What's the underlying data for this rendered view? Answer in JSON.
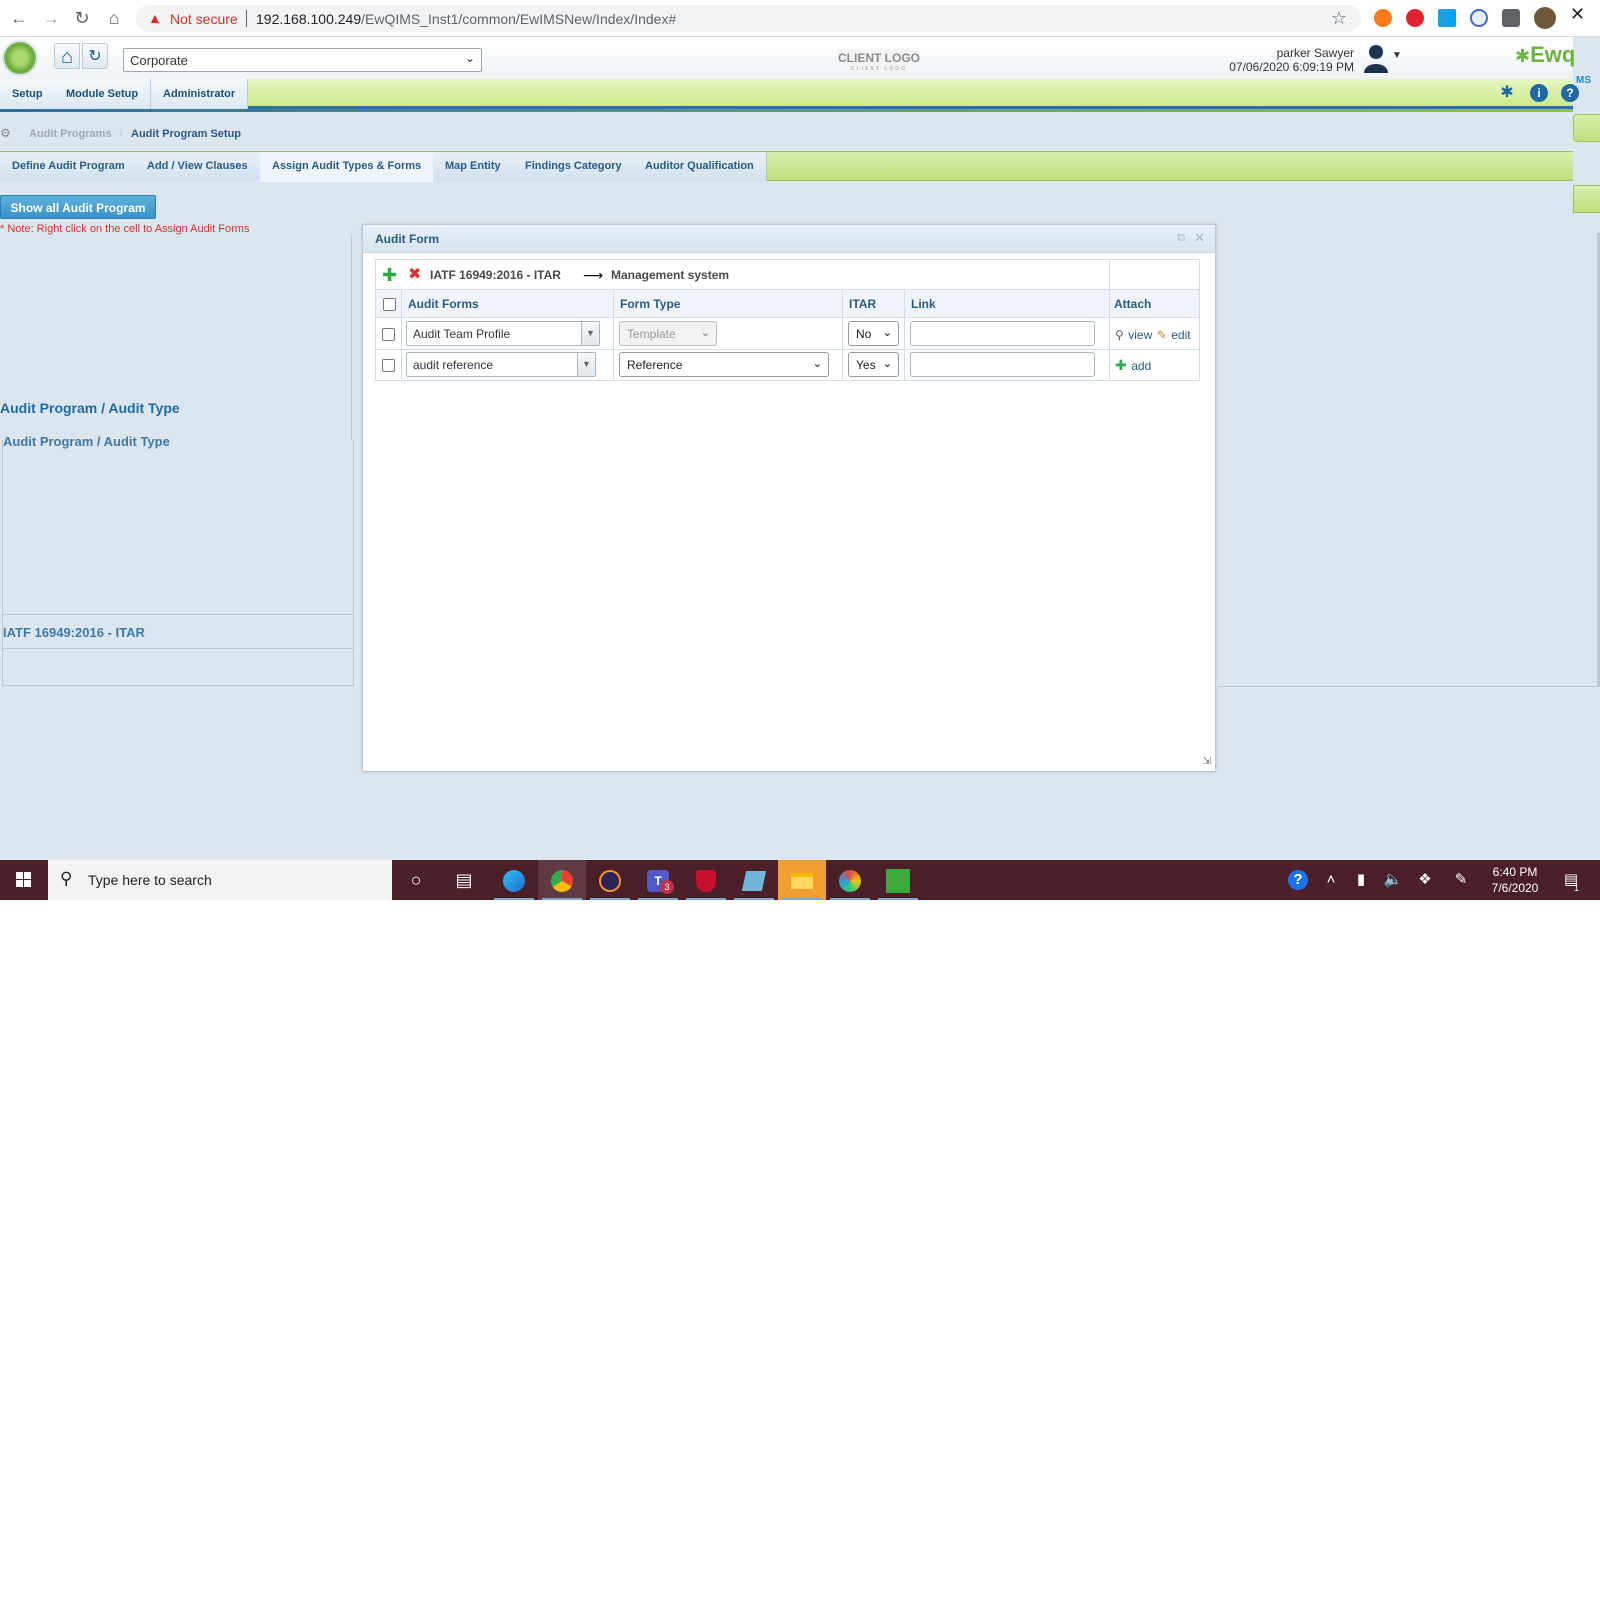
{
  "browser": {
    "security_label": "Not secure",
    "url_host": "192.168.100.249",
    "url_path": "/EwQIMS_Inst1/common/EwIMSNew/Index/Index#"
  },
  "header": {
    "site_selector": "Corporate",
    "client_logo": "CLIENT LOGO",
    "client_logo_sub": "CLIENT LOGO",
    "user_name": "parker Sawyer",
    "user_datetime": "07/06/2020 6:09:19 PM",
    "brand": "Ewq",
    "brand_sub": "MS"
  },
  "menu": {
    "items": [
      "Setup",
      "Module Setup",
      "Administrator"
    ]
  },
  "breadcrumb": {
    "items": [
      "Audit Programs",
      "Audit Program Setup"
    ]
  },
  "tabs": [
    {
      "label": "Define Audit Program"
    },
    {
      "label": "Add / View Clauses"
    },
    {
      "label": "Assign Audit Types & Forms",
      "active": true
    },
    {
      "label": "Map Entity"
    },
    {
      "label": "Findings Category"
    },
    {
      "label": "Auditor Qualification"
    }
  ],
  "left_panel": {
    "show_all_button": "Show all Audit Program",
    "note": "* Note: Right click on the cell to Assign Audit Forms",
    "header_label": "Audit Program / Audit Type",
    "header_label_2": "Audit Program / Audit Type",
    "row_label": "IATF 16949:2016 - ITAR"
  },
  "dialog": {
    "title": "Audit Form",
    "path_program": "IATF 16949:2016 - ITAR",
    "path_section": "Management system",
    "columns": {
      "forms": "Audit Forms",
      "type": "Form Type",
      "itar": "ITAR",
      "link": "Link",
      "attach": "Attach"
    },
    "rows": [
      {
        "form": "Audit Team Profile",
        "type": "Template",
        "itar": "No",
        "link": "",
        "attach": [
          "view",
          "edit"
        ]
      },
      {
        "form": "audit reference",
        "type": "Reference",
        "itar": "Yes",
        "link": "",
        "attach": [
          "add"
        ]
      }
    ]
  },
  "taskbar": {
    "search_placeholder": "Type here to search",
    "time": "6:40 PM",
    "date": "7/6/2020",
    "teams_badge": "3",
    "notification_count": "1"
  },
  "colors": {
    "accent_blue": "#2a5b86",
    "menu_green": "#cdea8a",
    "note_red": "#d9302b",
    "taskbar": "#4b1f28"
  }
}
